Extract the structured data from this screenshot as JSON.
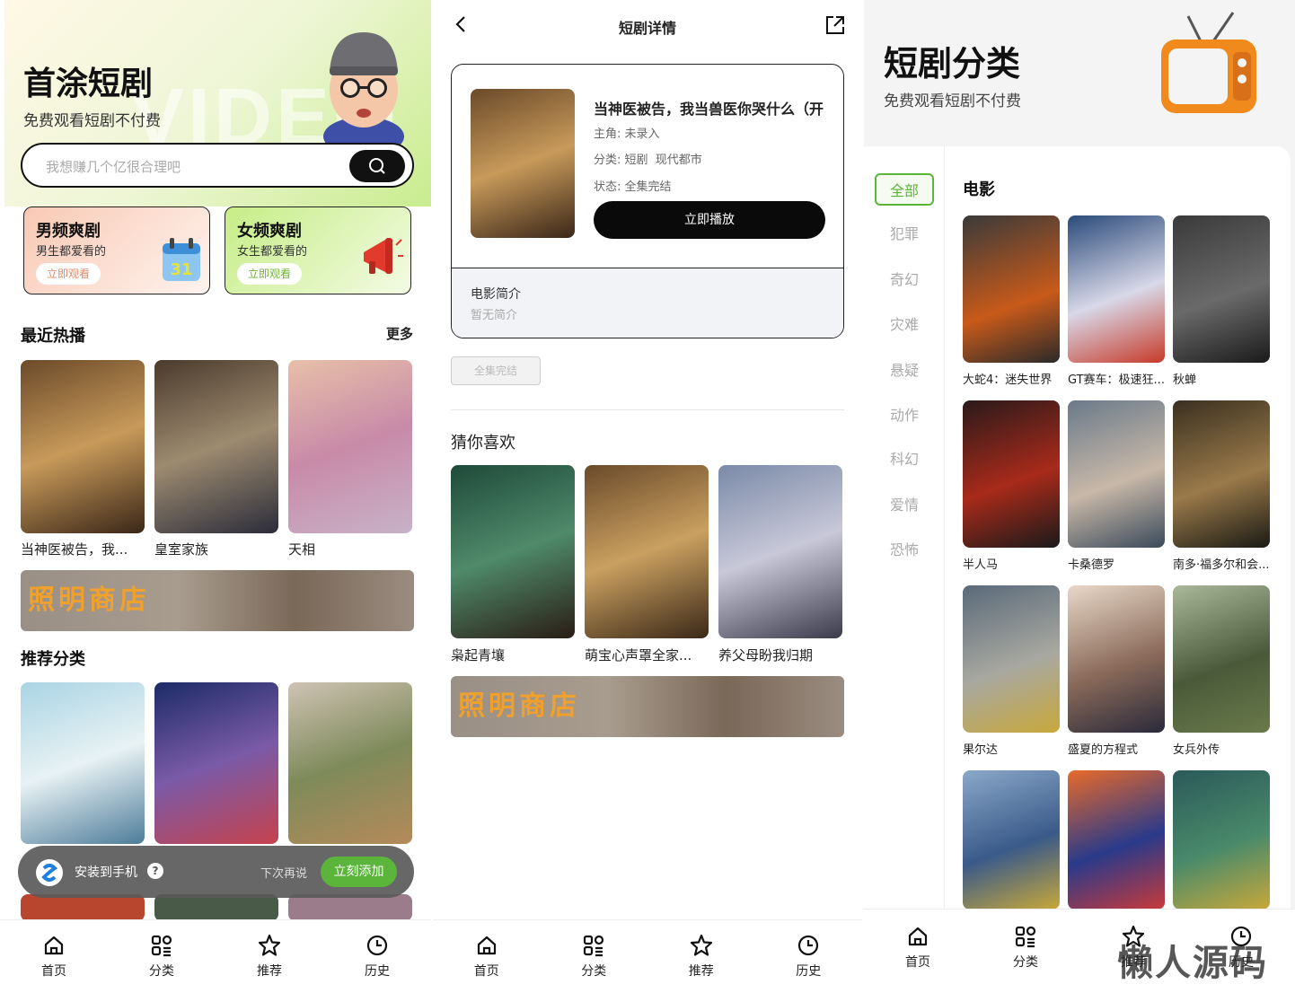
{
  "home": {
    "title": "首涂短剧",
    "subtitle": "免费观看短剧不付费",
    "bg_word": "VIDEO",
    "search_placeholder": "我想赚几个亿很合理吧",
    "cards": [
      {
        "title": "男频爽剧",
        "sub": "男生都爱看的",
        "btn": "立即观看",
        "color": "#f6c7b4"
      },
      {
        "title": "女频爽剧",
        "sub": "女生都爱看的",
        "btn": "立即观看",
        "color": "#c9ee8a"
      }
    ],
    "recent_title": "最近热播",
    "more": "更多",
    "recent": [
      {
        "name": "当神医被告，我..."
      },
      {
        "name": "皇室家族"
      },
      {
        "name": "天相"
      }
    ],
    "banner_text": "照明商店",
    "recommend_title": "推荐分类",
    "install": {
      "label": "安装到手机",
      "help": "?",
      "later": "下次再说",
      "add": "立刻添加"
    }
  },
  "detail": {
    "nav_title": "短剧详情",
    "title": "当神医被告，我当兽医你哭什么（开",
    "lead_label": "主角:",
    "lead": "未录入",
    "category_label": "分类:",
    "category": "短剧  现代都市",
    "status_label": "状态:",
    "status": "全集完结",
    "play": "立即播放",
    "intro_title": "电影简介",
    "intro": "暂无简介",
    "chip": "全集完结",
    "guess_title": "猜你喜欢",
    "guess": [
      {
        "name": "枭起青壤"
      },
      {
        "name": "萌宝心声罩全家..."
      },
      {
        "name": "养父母盼我归期"
      }
    ],
    "banner_text": "照明商店"
  },
  "category": {
    "title": "短剧分类",
    "subtitle": "免费观看短剧不付费",
    "nav": [
      "全部",
      "犯罪",
      "奇幻",
      "灾难",
      "悬疑",
      "动作",
      "科幻",
      "爱情",
      "恐怖"
    ],
    "section": "电影",
    "movies": [
      {
        "name": "大蛇4：迷失世界"
      },
      {
        "name": "GT赛车：极速狂..."
      },
      {
        "name": "秋蝉"
      },
      {
        "name": "半人马"
      },
      {
        "name": "卡桑德罗"
      },
      {
        "name": "南多·福多尔和会..."
      },
      {
        "name": "果尔达"
      },
      {
        "name": "盛夏的方程式"
      },
      {
        "name": "女兵外传"
      },
      {
        "name": ""
      },
      {
        "name": ""
      },
      {
        "name": ""
      }
    ]
  },
  "tabs": [
    "首页",
    "分类",
    "推荐",
    "历史"
  ],
  "watermark": "懒人源码",
  "colors": {
    "accent": "#5bb53a",
    "dark": "#0a0a0a"
  },
  "icons": [
    "search-icon",
    "back-icon",
    "share-icon",
    "home-icon",
    "category-icon",
    "star-icon",
    "clock-icon",
    "tv-icon",
    "calendar-icon",
    "megaphone-icon"
  ]
}
